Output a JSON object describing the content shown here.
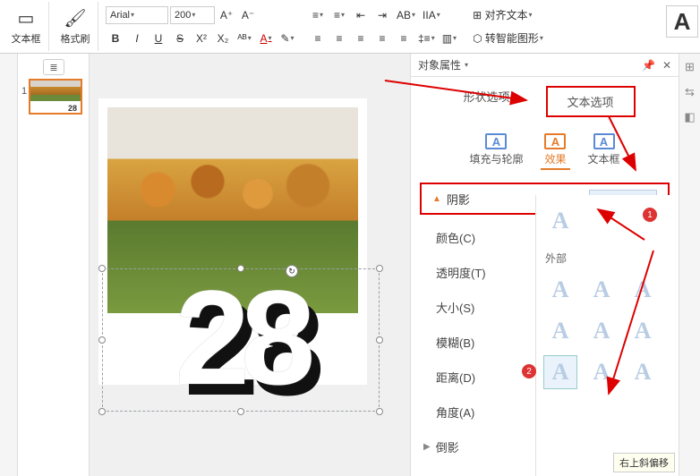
{
  "ribbon": {
    "textbox_label": "文本框",
    "format_painter_label": "格式刷",
    "font_name": "Arial",
    "font_size": "200",
    "increase_font": "A⁺",
    "decrease_font": "A⁻",
    "bold": "B",
    "italic": "I",
    "underline": "U",
    "strike": "S",
    "superscript": "X²",
    "subscript": "X₂",
    "align_text_label": "对齐文本",
    "convert_smart_label": "转智能图形",
    "big_a": "A"
  },
  "thumb": {
    "slide_number": "1",
    "mini_text": "28"
  },
  "slide": {
    "big_text": "28"
  },
  "rpane": {
    "header": "对象属性",
    "tab_shape": "形状选项",
    "tab_text": "文本选项",
    "sub_fill": "填充与轮廓",
    "sub_effect": "效果",
    "sub_textbox": "文本框",
    "section_shadow": "阴影",
    "prop_color": "颜色(C)",
    "prop_transparency": "透明度(T)",
    "prop_size": "大小(S)",
    "prop_blur": "模糊(B)",
    "prop_distance": "距离(D)",
    "prop_angle": "角度(A)",
    "section_reflection": "倒影",
    "gallery_outer": "外部",
    "tooltip": "右上斜偏移",
    "badge1": "1",
    "badge2": "2"
  }
}
